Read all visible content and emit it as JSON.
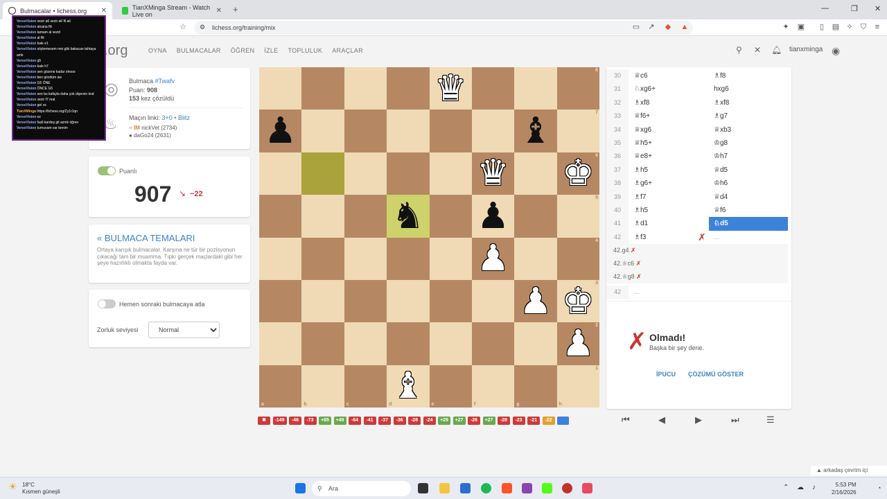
{
  "browser": {
    "tabs": [
      {
        "title": "Bulmacalar • lichess.org",
        "active": true
      },
      {
        "title": "TianXMinga Stream - Watch Live on",
        "active": false
      }
    ],
    "new_tab": "+",
    "url": "lichess.org/training/mix",
    "window_controls": [
      "—",
      "❐",
      "✕"
    ]
  },
  "site": {
    "logo": "s.org",
    "nav": [
      "OYNA",
      "BULMACALAR",
      "ÖĞREN",
      "İZLE",
      "TOPLULUK",
      "ARAÇLAR"
    ],
    "username": "tianxminga"
  },
  "chat": [
    {
      "user": "VerseVision",
      "msg": "vezir a6 vezir a6 fil a6"
    },
    {
      "user": "VerseVision",
      "msg": "atcana fili"
    },
    {
      "user": "VerseVision",
      "msg": "tamam al vezirl"
    },
    {
      "user": "VerseVision",
      "msg": "al fili"
    },
    {
      "user": "VerseVision",
      "msg": "kale e1"
    },
    {
      "user": "VerseVision",
      "msg": "söylemesem mei gibi bakacan tahtaya amk"
    },
    {
      "user": "VerseVision",
      "msg": "g5"
    },
    {
      "user": "VerseVision",
      "msg": "kale h7"
    },
    {
      "user": "VerseVision",
      "msg": "sen gözene kadar ohooo"
    },
    {
      "user": "VerseVision",
      "msg": "ben gözdüm aw"
    },
    {
      "user": "VerseVision",
      "msg": "G5 ÖNE"
    },
    {
      "user": "VerseVision",
      "msg": "ÖNCE G5"
    },
    {
      "user": "VerseVision",
      "msg": "sen bu kafayla daha çok dişersin kral"
    },
    {
      "user": "VerseVision",
      "msg": "vezir f7 mat"
    },
    {
      "user": "VerseVision",
      "msg": "gel vs"
    },
    {
      "user": "TianXMinga",
      "msg": "https://lichess.org/Zy1r1qn"
    },
    {
      "user": "VerseVision",
      "msg": "ez"
    },
    {
      "user": "VerseVision",
      "msg": "fazli kardeş git azmk öğren"
    },
    {
      "user": "VerseVision",
      "msg": "turnuvam var benim"
    }
  ],
  "puzzle_info": {
    "label": "Bulmaca",
    "id": "#Twafv",
    "rating_label": "Puan:",
    "rating": "908",
    "solved_count": "153",
    "solved_label": "kez çözüldü",
    "game_label": "Maçın linki:",
    "game_link": "3+0 • Blitz",
    "white_title": "IM",
    "white_player": "nickVet (2734)",
    "black_player": "daGo24 (2631)"
  },
  "rated": {
    "label": "Puanlı",
    "rating": "907",
    "diff": "−22"
  },
  "themes": {
    "title": "« BULMACA TEMALARI",
    "desc": "Ortaya karışık bulmacalar. Karşına ne tür bir pozisyonun çıkacağı tam bir muamma. Tıpkı gerçek maçlardaki gibi her şeye hazırlıklı olmakta fayda var."
  },
  "settings": {
    "autonext_label": "Hemen sonraki bulmacaya atla",
    "difficulty_label": "Zorluk seviyesi",
    "difficulty_value": "Normal"
  },
  "board": {
    "files": [
      "a",
      "b",
      "c",
      "d",
      "e",
      "f",
      "g",
      "h"
    ],
    "ranks": [
      "8",
      "7",
      "6",
      "5",
      "4",
      "3",
      "2",
      "1"
    ],
    "pieces": [
      {
        "sq": "e8",
        "glyph": "♛",
        "color": "w"
      },
      {
        "sq": "a7",
        "glyph": "♟",
        "color": "b"
      },
      {
        "sq": "g7",
        "glyph": "♝",
        "color": "b"
      },
      {
        "sq": "f6",
        "glyph": "♛",
        "color": "w"
      },
      {
        "sq": "h6",
        "glyph": "♚",
        "color": "w"
      },
      {
        "sq": "d5",
        "glyph": "♞",
        "color": "b"
      },
      {
        "sq": "f5",
        "glyph": "♟",
        "color": "b"
      },
      {
        "sq": "f4",
        "glyph": "♟",
        "color": "w"
      },
      {
        "sq": "g3",
        "glyph": "♟",
        "color": "w"
      },
      {
        "sq": "h3",
        "glyph": "♚",
        "color": "w"
      },
      {
        "sq": "h2",
        "glyph": "♟",
        "color": "w"
      },
      {
        "sq": "d1",
        "glyph": "♝",
        "color": "w"
      }
    ],
    "highlight_from": "b6",
    "highlight_to": "d5"
  },
  "moves": [
    {
      "n": "30",
      "w": "♕c6",
      "b": "♗f8"
    },
    {
      "n": "31",
      "w": "♘xg6+",
      "b": "hxg6"
    },
    {
      "n": "32",
      "w": "♗xf8",
      "b": "♗xf8"
    },
    {
      "n": "33",
      "w": "♕f6+",
      "b": "♗g7"
    },
    {
      "n": "34",
      "w": "♕xg6",
      "b": "♕xb3"
    },
    {
      "n": "35",
      "w": "♕h5+",
      "b": "♔g8"
    },
    {
      "n": "36",
      "w": "♕e8+",
      "b": "♔h7"
    },
    {
      "n": "37",
      "w": "♗h5",
      "b": "♕d5"
    },
    {
      "n": "38",
      "w": "♗g6+",
      "b": "♔h6"
    },
    {
      "n": "39",
      "w": "♗f7",
      "b": "♕d4"
    },
    {
      "n": "40",
      "w": "♗h5",
      "b": "♕f6"
    },
    {
      "n": "41",
      "w": "♗d1",
      "b": "♘d5"
    },
    {
      "n": "42",
      "w": "♗f3",
      "b": "..."
    }
  ],
  "alternatives": [
    "42.g4",
    "42.♕c6",
    "42.♕g8"
  ],
  "alt_last": {
    "n": "42",
    "b": "..."
  },
  "fail": {
    "title": "Olmadı!",
    "subtitle": "Başka bir şey dene.",
    "hint": "İPUCU",
    "show_solution": "ÇÖZÜMÜ GÖSTER"
  },
  "history": [
    {
      "v": "✖",
      "c": "r"
    },
    {
      "v": "-149",
      "c": "r"
    },
    {
      "v": "-46",
      "c": "r"
    },
    {
      "v": "-73",
      "c": "r"
    },
    {
      "v": "+85",
      "c": "g"
    },
    {
      "v": "+49",
      "c": "g"
    },
    {
      "v": "-64",
      "c": "r"
    },
    {
      "v": "-41",
      "c": "r"
    },
    {
      "v": "-37",
      "c": "r"
    },
    {
      "v": "-36",
      "c": "r"
    },
    {
      "v": "-28",
      "c": "r"
    },
    {
      "v": "-24",
      "c": "r"
    },
    {
      "v": "+29",
      "c": "g"
    },
    {
      "v": "+27",
      "c": "g"
    },
    {
      "v": "-26",
      "c": "r"
    },
    {
      "v": "+27",
      "c": "g"
    },
    {
      "v": "-28",
      "c": "r"
    },
    {
      "v": "-23",
      "c": "r"
    },
    {
      "v": "-21",
      "c": "r"
    },
    {
      "v": "-22",
      "c": "y"
    },
    {
      "v": "",
      "c": "b"
    }
  ],
  "controls": [
    "⏮",
    "◀",
    "▶",
    "⏭",
    "☰"
  ],
  "friends": "▲ arkadaş çevrim içi",
  "taskbar": {
    "temp": "18°C",
    "weather": "Kısmen güneşli",
    "search": "Ara",
    "time": "5:53 PM",
    "date": "2/16/2026"
  },
  "colors": {
    "accent": "#3b83d9",
    "error": "#cc3333",
    "board_light": "#f0d9b5",
    "board_dark": "#b58863"
  }
}
